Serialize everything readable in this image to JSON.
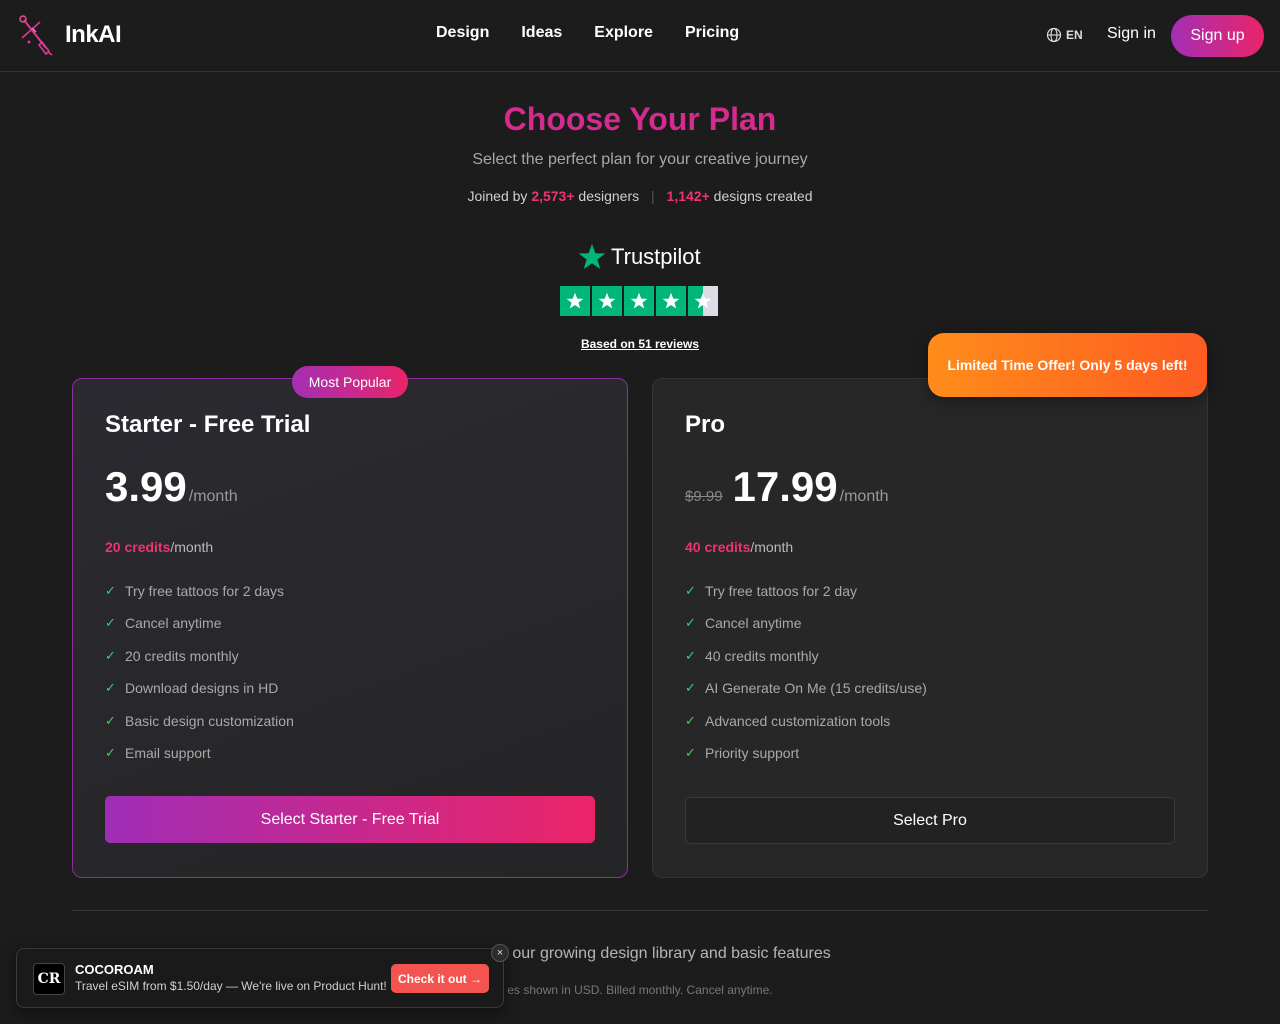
{
  "header": {
    "logo_text": "InkAI",
    "nav": [
      {
        "label": "Design"
      },
      {
        "label": "Ideas"
      },
      {
        "label": "Explore"
      },
      {
        "label": "Pricing"
      }
    ],
    "lang": "EN",
    "signin": "Sign in",
    "signup": "Sign up"
  },
  "hero": {
    "title": "Choose Your Plan",
    "subtitle": "Select the perfect plan for your creative journey",
    "stats": {
      "prefix": "Joined by",
      "designers_count": "2,573+",
      "designers_label": "designers",
      "sep": "|",
      "designs_count": "1,142+",
      "designs_label": "designs created"
    }
  },
  "trustpilot": {
    "brand": "Trustpilot",
    "rating": 4.5,
    "reviews_text": "Based on 51 reviews",
    "colors": {
      "star_bg": "#00b67a",
      "logo_star": "#00b67a"
    }
  },
  "plans": {
    "starter": {
      "badge": "Most Popular",
      "name": "Starter - Free Trial",
      "price": "3.99",
      "period": "/month",
      "credits": "20 credits",
      "credits_period": "/month",
      "features": [
        "Try free tattoos for 2 days",
        "Cancel anytime",
        "20 credits monthly",
        "Download designs in HD",
        "Basic design customization",
        "Email support"
      ],
      "button": "Select Starter - Free Trial"
    },
    "pro": {
      "badge": "Limited Time Offer! Only 5 days left!",
      "name": "Pro",
      "old_price": "$9.99",
      "price": "17.99",
      "period": "/month",
      "credits": "40 credits",
      "credits_period": "/month",
      "features": [
        "Try free tattoos for 2 day",
        "Cancel anytime",
        "40 credits monthly",
        "AI Generate On Me (15 credits/use)",
        "Advanced customization tools",
        "Priority support"
      ],
      "button": "Select Pro"
    }
  },
  "footer": {
    "text": "ccess to our growing design library and basic features",
    "note": "es shown in USD. Billed monthly. Cancel anytime."
  },
  "toast": {
    "logo": "CR",
    "title": "COCOROAM",
    "desc": "Travel eSIM from $1.50/day — We're live on Product Hunt!",
    "button": "Check it out →",
    "close": "×"
  },
  "colors": {
    "accent_pink": "#f0336f",
    "accent_purple": "#a42fb4",
    "check_green": "#3fcf6a",
    "offer_orange": "#ff8c1a"
  }
}
